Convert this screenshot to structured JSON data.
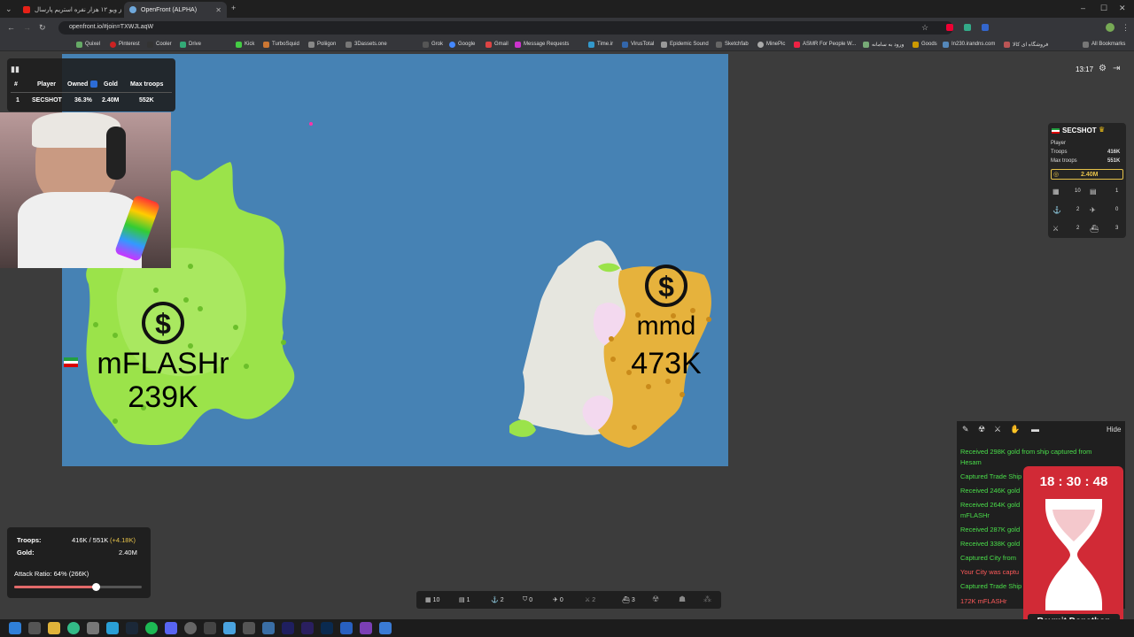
{
  "browser": {
    "tabs": [
      {
        "title": "از ویو ۱۲ هزار نفره استریم پارسال..."
      },
      {
        "title": "OpenFront (ALPHA)"
      }
    ],
    "url": "openfront.io/#join=TXWJLaqW",
    "bookmarks": [
      "Quixel",
      "Pinterest",
      "Cooler",
      "Drive",
      "Kick",
      "TurboSquid",
      "Poliigon",
      "3Dassets.one",
      "Grok",
      "Google",
      "Gmail",
      "Message Requests",
      "Time.ir",
      "VirusTotal",
      "Epidemic Sound",
      "Sketchfab",
      "MinePic",
      "ASMR For People W...",
      "ورود به سامانه",
      "Goods",
      "In230.irandns.com",
      "فروشگاه ای کالا",
      "All Bookmarks"
    ]
  },
  "leaderboard": {
    "headers": [
      "#",
      "Player",
      "Owned",
      "Gold",
      "Max troops"
    ],
    "rows": [
      {
        "rank": "1",
        "player": "SECSHOT",
        "owned": "36.3%",
        "gold": "2.40M",
        "max_troops": "552K"
      }
    ]
  },
  "clock": "13:17",
  "map": {
    "players": [
      {
        "name": "mFLASHr",
        "troops": "239K",
        "color": "#9be34a"
      },
      {
        "name": "mmd",
        "troops": "473K",
        "color": "#e6b23c"
      }
    ]
  },
  "player_panel": {
    "name": "SECSHOT",
    "type": "Player",
    "troops_label": "Troops",
    "troops": "416K",
    "max_troops_label": "Max troops",
    "max_troops": "551K",
    "gold": "2.40M",
    "counts": [
      "10",
      "1",
      "2",
      "0",
      "2",
      "3"
    ]
  },
  "events": {
    "hide_label": "Hide",
    "messages": [
      {
        "text": "Received 298K gold from ship captured from",
        "red": false
      },
      {
        "text": "Hesam",
        "red": false
      },
      {
        "text": "Captured Trade Ship",
        "red": false
      },
      {
        "text": "Received 246K gold",
        "red": false
      },
      {
        "text": "Received 264K gold",
        "red": false
      },
      {
        "text": "mFLASHr",
        "red": false
      },
      {
        "text": "Received 287K gold",
        "red": false
      },
      {
        "text": "Received 338K gold",
        "red": false
      },
      {
        "text": "Captured City from",
        "red": false
      },
      {
        "text": "Your City was captu",
        "red": true
      },
      {
        "text": "Captured Trade Ship",
        "red": false
      },
      {
        "text": "172K mFLASHr",
        "red": true
      }
    ]
  },
  "timer": {
    "time": "18 : 30 : 48",
    "name": "Reymit Donathon"
  },
  "stats": {
    "troops_label": "Troops:",
    "troops": "416K / 551K",
    "troops_delta": "(+4.18K)",
    "gold_label": "Gold:",
    "gold": "2.40M",
    "attack_ratio": "Attack Ratio: 64% (266K)",
    "attack_ratio_value": 0.64
  },
  "buildbar": {
    "counts": [
      "10",
      "1",
      "2",
      "0",
      "0",
      "2",
      "3"
    ]
  },
  "colors": {
    "ocean": "#4682b4",
    "green_player": "#9be34a",
    "orange_player": "#e6b23c",
    "accent_gold": "#e5c14a"
  }
}
